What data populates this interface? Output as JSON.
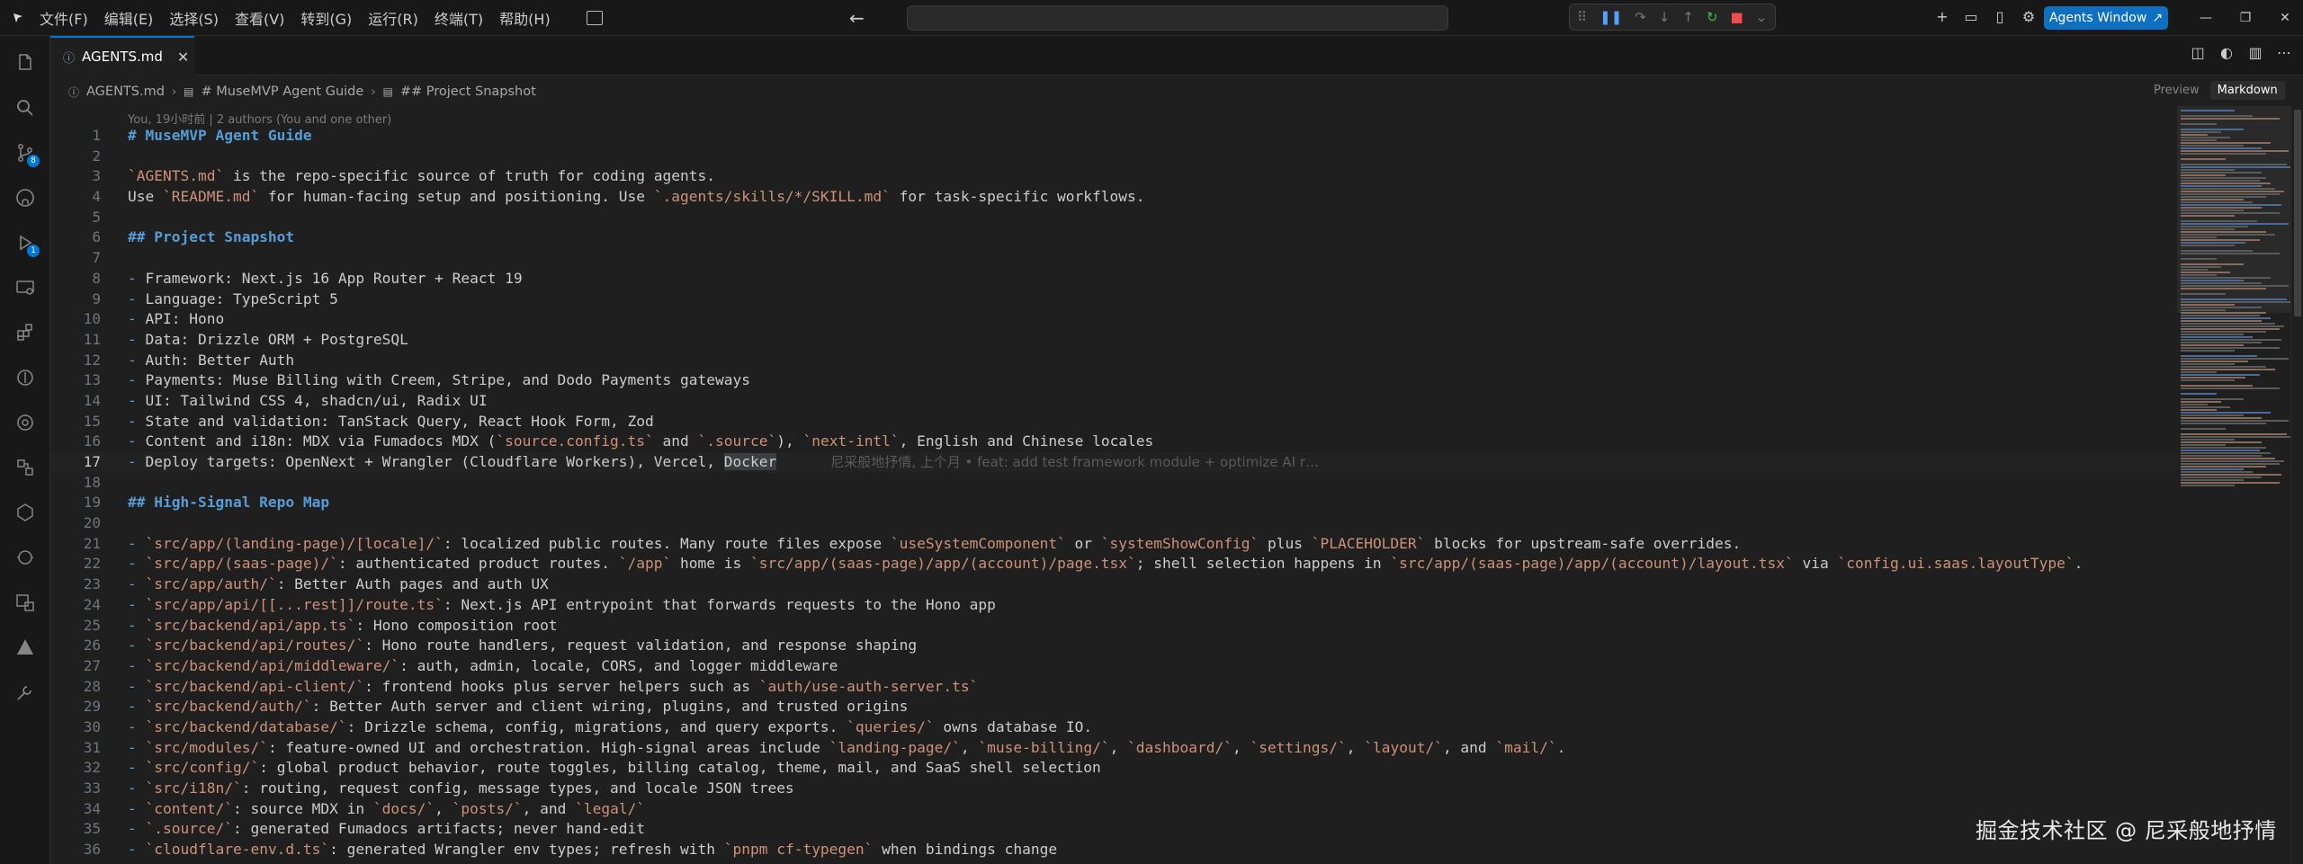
{
  "menu": [
    "文件(F)",
    "编辑(E)",
    "选择(S)",
    "查看(V)",
    "转到(G)",
    "运行(R)",
    "终端(T)",
    "帮助(H)"
  ],
  "agents_button": "Agents Window",
  "tab": {
    "label": "AGENTS.md"
  },
  "breadcrumb": [
    "AGENTS.md",
    "# MuseMVP Agent Guide",
    "## Project Snapshot"
  ],
  "preview_buttons": {
    "preview": "Preview",
    "markdown": "Markdown"
  },
  "blame_header": "You, 19小时前 | 2 authors (You and one other)",
  "current_line": 17,
  "inline_blame": "尼采般地抒情, 上个月 • feat: add test framework module + optimize AI r…",
  "code_lines": [
    [
      {
        "t": "# MuseMVP Agent Guide",
        "c": "h"
      }
    ],
    [],
    [
      {
        "t": "`AGENTS.md`",
        "c": "m"
      },
      {
        "t": " is the repo-specific source of truth for coding agents."
      }
    ],
    [
      {
        "t": "Use "
      },
      {
        "t": "`README.md`",
        "c": "m"
      },
      {
        "t": " for human-facing setup and positioning. Use "
      },
      {
        "t": "`.agents/skills/*/SKILL.md`",
        "c": "m"
      },
      {
        "t": " for task-specific workflows."
      }
    ],
    [],
    [
      {
        "t": "## Project Snapshot",
        "c": "h"
      }
    ],
    [],
    [
      {
        "t": "-",
        "c": "d"
      },
      {
        "t": " Framework: Next.js 16 App Router + React 19"
      }
    ],
    [
      {
        "t": "-",
        "c": "d"
      },
      {
        "t": " Language: TypeScript 5"
      }
    ],
    [
      {
        "t": "-",
        "c": "d"
      },
      {
        "t": " API: Hono"
      }
    ],
    [
      {
        "t": "-",
        "c": "d"
      },
      {
        "t": " Data: Drizzle ORM + PostgreSQL"
      }
    ],
    [
      {
        "t": "-",
        "c": "d"
      },
      {
        "t": " Auth: Better Auth"
      }
    ],
    [
      {
        "t": "-",
        "c": "d"
      },
      {
        "t": " Payments: Muse Billing with Creem, Stripe, and Dodo Payments gateways"
      }
    ],
    [
      {
        "t": "-",
        "c": "d"
      },
      {
        "t": " UI: Tailwind CSS 4, shadcn/ui, Radix UI"
      }
    ],
    [
      {
        "t": "-",
        "c": "d"
      },
      {
        "t": " State and validation: TanStack Query, React Hook Form, Zod"
      }
    ],
    [
      {
        "t": "-",
        "c": "d"
      },
      {
        "t": " Content and i18n: MDX via Fumadocs MDX ("
      },
      {
        "t": "`source.config.ts`",
        "c": "m"
      },
      {
        "t": " and "
      },
      {
        "t": "`.source`",
        "c": "m"
      },
      {
        "t": "), "
      },
      {
        "t": "`next-intl`",
        "c": "m"
      },
      {
        "t": ", English and Chinese locales"
      }
    ],
    [
      {
        "t": "-",
        "c": "d"
      },
      {
        "t": " Deploy targets: OpenNext + Wrangler (Cloudflare Workers), Vercel, "
      },
      {
        "t": "Docker",
        "c": "cur"
      }
    ],
    [],
    [
      {
        "t": "## High-Signal Repo Map",
        "c": "h"
      }
    ],
    [],
    [
      {
        "t": "-",
        "c": "d"
      },
      {
        "t": " "
      },
      {
        "t": "`src/app/(landing-page)/[locale]/`",
        "c": "m"
      },
      {
        "t": ": localized public routes. Many route files expose "
      },
      {
        "t": "`useSystemComponent`",
        "c": "m"
      },
      {
        "t": " or "
      },
      {
        "t": "`systemShowConfig`",
        "c": "m"
      },
      {
        "t": " plus "
      },
      {
        "t": "`PLACEHOLDER`",
        "c": "m"
      },
      {
        "t": " blocks for upstream-safe overrides."
      }
    ],
    [
      {
        "t": "-",
        "c": "d"
      },
      {
        "t": " "
      },
      {
        "t": "`src/app/(saas-page)/`",
        "c": "m"
      },
      {
        "t": ": authenticated product routes. "
      },
      {
        "t": "`/app`",
        "c": "m"
      },
      {
        "t": " home is "
      },
      {
        "t": "`src/app/(saas-page)/app/(account)/page.tsx`",
        "c": "m"
      },
      {
        "t": "; shell selection happens in "
      },
      {
        "t": "`src/app/(saas-page)/app/(account)/layout.tsx`",
        "c": "m"
      },
      {
        "t": " via "
      },
      {
        "t": "`config.ui.saas.layoutType`",
        "c": "m"
      },
      {
        "t": "."
      }
    ],
    [
      {
        "t": "-",
        "c": "d"
      },
      {
        "t": " "
      },
      {
        "t": "`src/app/auth/`",
        "c": "m"
      },
      {
        "t": ": Better Auth pages and auth UX"
      }
    ],
    [
      {
        "t": "-",
        "c": "d"
      },
      {
        "t": " "
      },
      {
        "t": "`src/app/api/[[...rest]]/route.ts`",
        "c": "m"
      },
      {
        "t": ": Next.js API entrypoint that forwards requests to the Hono app"
      }
    ],
    [
      {
        "t": "-",
        "c": "d"
      },
      {
        "t": " "
      },
      {
        "t": "`src/backend/api/app.ts`",
        "c": "m"
      },
      {
        "t": ": Hono composition root"
      }
    ],
    [
      {
        "t": "-",
        "c": "d"
      },
      {
        "t": " "
      },
      {
        "t": "`src/backend/api/routes/`",
        "c": "m"
      },
      {
        "t": ": Hono route handlers, request validation, and response shaping"
      }
    ],
    [
      {
        "t": "-",
        "c": "d"
      },
      {
        "t": " "
      },
      {
        "t": "`src/backend/api/middleware/`",
        "c": "m"
      },
      {
        "t": ": auth, admin, locale, CORS, and logger middleware"
      }
    ],
    [
      {
        "t": "-",
        "c": "d"
      },
      {
        "t": " "
      },
      {
        "t": "`src/backend/api-client/`",
        "c": "m"
      },
      {
        "t": ": frontend hooks plus server helpers such as "
      },
      {
        "t": "`auth/use-auth-server.ts`",
        "c": "m"
      }
    ],
    [
      {
        "t": "-",
        "c": "d"
      },
      {
        "t": " "
      },
      {
        "t": "`src/backend/auth/`",
        "c": "m"
      },
      {
        "t": ": Better Auth server and client wiring, plugins, and trusted origins"
      }
    ],
    [
      {
        "t": "-",
        "c": "d"
      },
      {
        "t": " "
      },
      {
        "t": "`src/backend/database/`",
        "c": "m"
      },
      {
        "t": ": Drizzle schema, config, migrations, and query exports. "
      },
      {
        "t": "`queries/`",
        "c": "m"
      },
      {
        "t": " owns database IO."
      }
    ],
    [
      {
        "t": "-",
        "c": "d"
      },
      {
        "t": " "
      },
      {
        "t": "`src/modules/`",
        "c": "m"
      },
      {
        "t": ": feature-owned UI and orchestration. High-signal areas include "
      },
      {
        "t": "`landing-page/`",
        "c": "m"
      },
      {
        "t": ", "
      },
      {
        "t": "`muse-billing/`",
        "c": "m"
      },
      {
        "t": ", "
      },
      {
        "t": "`dashboard/`",
        "c": "m"
      },
      {
        "t": ", "
      },
      {
        "t": "`settings/`",
        "c": "m"
      },
      {
        "t": ", "
      },
      {
        "t": "`layout/`",
        "c": "m"
      },
      {
        "t": ", and "
      },
      {
        "t": "`mail/`",
        "c": "m"
      },
      {
        "t": "."
      }
    ],
    [
      {
        "t": "-",
        "c": "d"
      },
      {
        "t": " "
      },
      {
        "t": "`src/config/`",
        "c": "m"
      },
      {
        "t": ": global product behavior, route toggles, billing catalog, theme, mail, and SaaS shell selection"
      }
    ],
    [
      {
        "t": "-",
        "c": "d"
      },
      {
        "t": " "
      },
      {
        "t": "`src/i18n/`",
        "c": "m"
      },
      {
        "t": ": routing, request config, message types, and locale JSON trees"
      }
    ],
    [
      {
        "t": "-",
        "c": "d"
      },
      {
        "t": " "
      },
      {
        "t": "`content/`",
        "c": "m"
      },
      {
        "t": ": source MDX in "
      },
      {
        "t": "`docs/`",
        "c": "m"
      },
      {
        "t": ", "
      },
      {
        "t": "`posts/`",
        "c": "m"
      },
      {
        "t": ", and "
      },
      {
        "t": "`legal/`",
        "c": "m"
      }
    ],
    [
      {
        "t": "-",
        "c": "d"
      },
      {
        "t": " "
      },
      {
        "t": "`.source/`",
        "c": "m"
      },
      {
        "t": ": generated Fumadocs artifacts; never hand-edit"
      }
    ],
    [
      {
        "t": "-",
        "c": "d"
      },
      {
        "t": " "
      },
      {
        "t": "`cloudflare-env.d.ts`",
        "c": "m"
      },
      {
        "t": ": generated Wrangler env types; refresh with "
      },
      {
        "t": "`pnpm cf-typegen`",
        "c": "m"
      },
      {
        "t": " when bindings change"
      }
    ]
  ],
  "watermark": "掘金技术社区 @ 尼采般地抒情",
  "activity_badges": {
    "source_control": "8",
    "run_debug": "1"
  },
  "colors": {
    "accent": "#0078d4",
    "agents_button": "#0e70c0",
    "heading": "#569cd6",
    "inline_code": "#ce9178"
  }
}
